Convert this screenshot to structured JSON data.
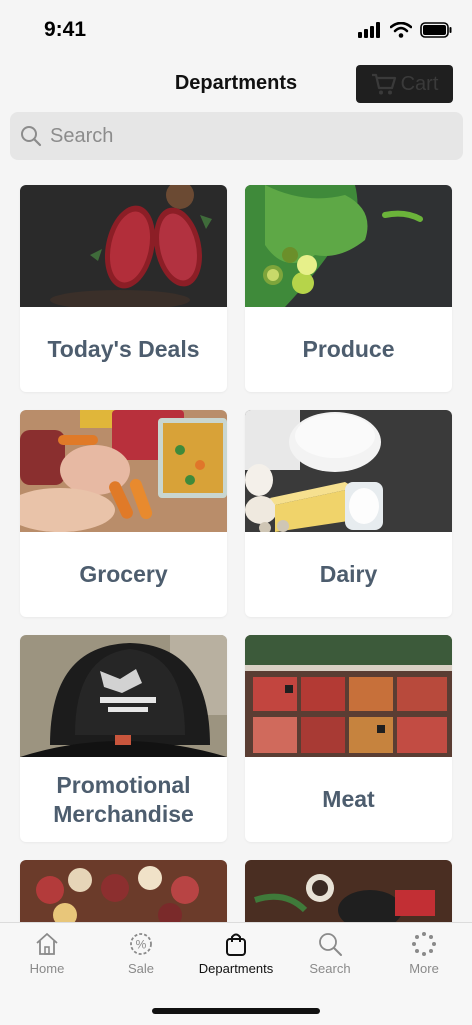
{
  "status": {
    "time": "9:41"
  },
  "header": {
    "title": "Departments",
    "cart_label": "Cart"
  },
  "search": {
    "placeholder": "Search"
  },
  "departments": [
    {
      "label": "Today's Deals"
    },
    {
      "label": "Produce"
    },
    {
      "label": "Grocery"
    },
    {
      "label": "Dairy"
    },
    {
      "label": "Promotional Merchandise"
    },
    {
      "label": "Meat"
    }
  ],
  "tabs": [
    {
      "label": "Home",
      "icon": "home-icon"
    },
    {
      "label": "Sale",
      "icon": "sale-icon"
    },
    {
      "label": "Departments",
      "icon": "bag-icon",
      "active": true
    },
    {
      "label": "Search",
      "icon": "search-icon"
    },
    {
      "label": "More",
      "icon": "more-icon"
    }
  ],
  "colors": {
    "label": "#4d5d6e",
    "cart_bg": "#1f1f1f",
    "background": "#f5f5f5"
  }
}
